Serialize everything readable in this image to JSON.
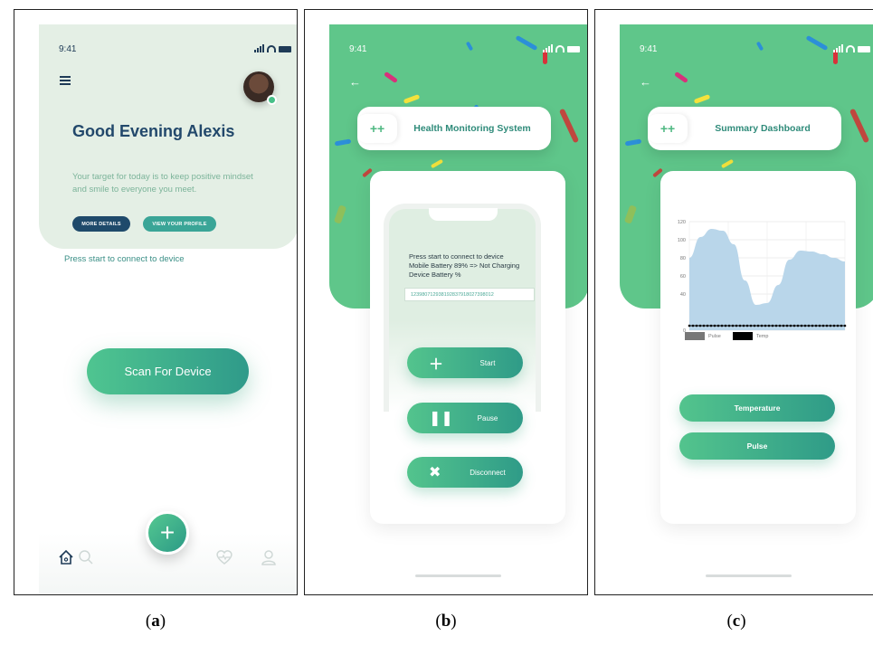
{
  "status_bar": {
    "time": "9:41"
  },
  "panel_a": {
    "greeting": "Good Evening Alexis",
    "target_text": "Your target for today is to keep positive mindset and smile to everyone you meet.",
    "more_details_label": "MORE DETAILS",
    "view_profile_label": "VIEW YOUR PROFILE",
    "press_start_text": "Press start to connect to device",
    "scan_button_label": "Scan For Device",
    "fab_label": "+",
    "nav_icons": [
      "home-icon",
      "search-icon",
      "heart-monitor-icon",
      "user-icon"
    ]
  },
  "panel_b": {
    "title": "Health Monitoring System",
    "tab_label": "++",
    "status_line_1": "Press start to connect to device",
    "status_line_2": "Mobile Battery 89% => Not Charging",
    "status_line_3": "Device Battery %",
    "device_id_value": "123980712938192837918027398012",
    "start_label": "Start",
    "pause_label": "Pause",
    "disconnect_label": "Disconnect"
  },
  "panel_c": {
    "title": "Summary Dashboard",
    "tab_label": "++",
    "temperature_label": "Temperature",
    "pulse_label": "Pulse"
  },
  "chart_data": {
    "type": "area",
    "ylim": [
      0,
      120
    ],
    "yticks": [
      0,
      40,
      60,
      80,
      100,
      120
    ],
    "grid": true,
    "legend": "bottom",
    "series": [
      {
        "name": "Pulse",
        "color": "#b9d6ea",
        "values": [
          80,
          103,
          112,
          110,
          95,
          55,
          28,
          30,
          50,
          78,
          88,
          87,
          84,
          80,
          76
        ]
      },
      {
        "name": "Temp",
        "color": "#000000",
        "values": [
          5,
          5,
          5,
          5,
          5,
          5,
          5,
          5,
          5,
          5,
          5,
          5,
          5,
          5,
          5
        ]
      }
    ],
    "legend_swatches": {
      "Pulse": "#777777",
      "Temp": "#000000"
    }
  },
  "captions": [
    "a",
    "b",
    "c"
  ],
  "colors": {
    "accent_green": "#5fc68a",
    "navy": "#1f3b57",
    "teal": "#3aa597"
  }
}
